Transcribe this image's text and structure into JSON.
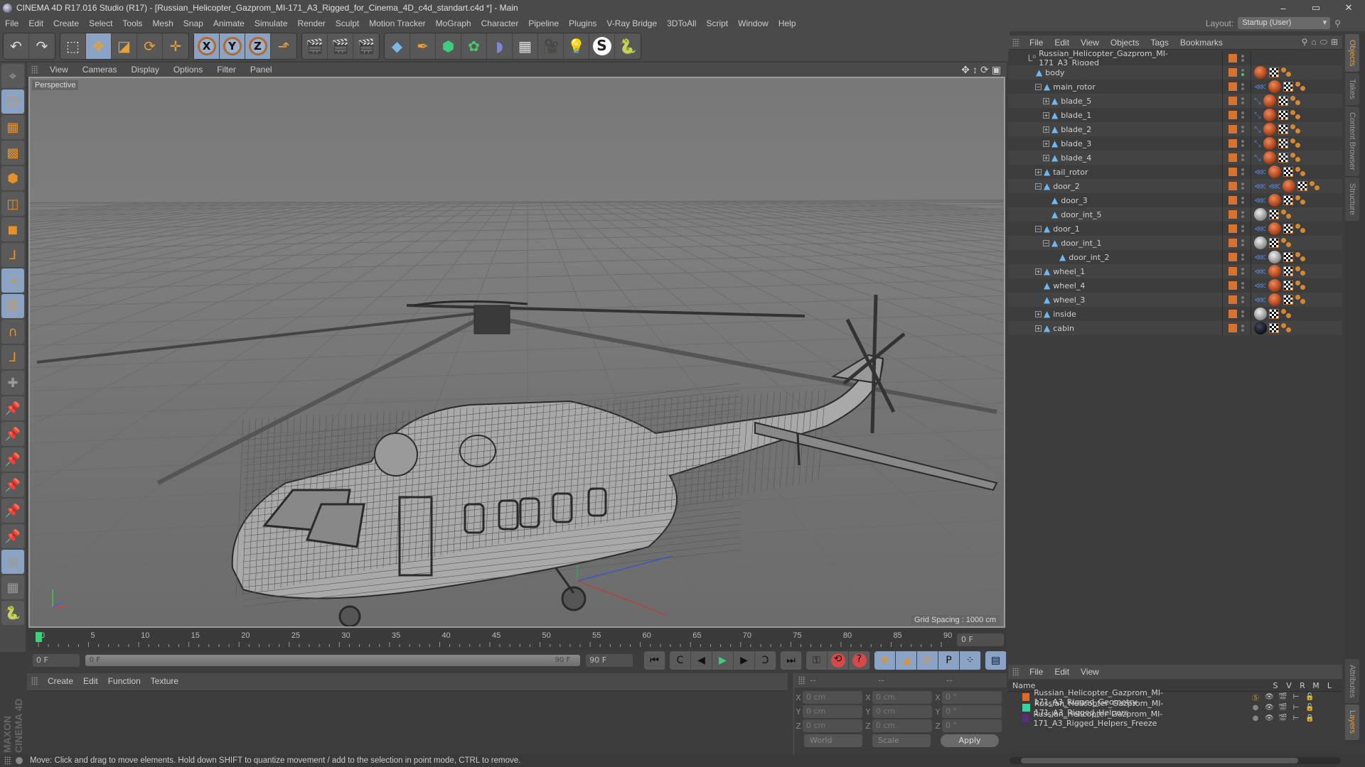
{
  "window": {
    "title": "CINEMA 4D R17.016 Studio (R17) - [Russian_Helicopter_Gazprom_MI-171_A3_Rigged_for_Cinema_4D_c4d_standart.c4d *] - Main",
    "controls": {
      "minimize": "–",
      "maximize": "▭",
      "close": "✕"
    }
  },
  "menubar": {
    "items": [
      "File",
      "Edit",
      "Create",
      "Select",
      "Tools",
      "Mesh",
      "Snap",
      "Animate",
      "Simulate",
      "Render",
      "Sculpt",
      "Motion Tracker",
      "MoGraph",
      "Character",
      "Pipeline",
      "Plugins",
      "V-Ray Bridge",
      "3DToAll",
      "Script",
      "Window",
      "Help"
    ],
    "layout_label": "Layout:",
    "layout_value": "Startup (User)"
  },
  "toolbar": {
    "buttons": [
      {
        "icon": "undo-icon",
        "glyph": "↶"
      },
      {
        "icon": "redo-icon",
        "glyph": "↷"
      },
      {
        "icon": "live-selection-icon",
        "glyph": "⬚"
      },
      {
        "icon": "move-icon",
        "glyph": "✥"
      },
      {
        "icon": "scale-icon",
        "glyph": "◪"
      },
      {
        "icon": "rotate-icon",
        "glyph": "⟳"
      },
      {
        "icon": "last-tool-icon",
        "glyph": "✛"
      },
      {
        "icon": "x-axis-icon",
        "glyph": "X"
      },
      {
        "icon": "y-axis-icon",
        "glyph": "Y"
      },
      {
        "icon": "z-axis-icon",
        "glyph": "Z"
      },
      {
        "icon": "coordinate-system-icon",
        "glyph": "⬏"
      },
      {
        "icon": "render-view-icon",
        "glyph": "🎬"
      },
      {
        "icon": "render-picture-viewer-icon",
        "glyph": "🎬"
      },
      {
        "icon": "render-settings-icon",
        "glyph": "🎬"
      },
      {
        "icon": "cube-icon",
        "glyph": "◆"
      },
      {
        "icon": "pen-icon",
        "glyph": "✒"
      },
      {
        "icon": "subdivision-icon",
        "glyph": "⬢"
      },
      {
        "icon": "cloner-icon",
        "glyph": "✿"
      },
      {
        "icon": "deformer-icon",
        "glyph": "◗"
      },
      {
        "icon": "floor-icon",
        "glyph": "▦"
      },
      {
        "icon": "camera-icon",
        "glyph": "🎥"
      },
      {
        "icon": "light-icon",
        "glyph": "💡"
      },
      {
        "icon": "vray-icon",
        "glyph": "S"
      },
      {
        "icon": "python-icon",
        "glyph": "🐍"
      }
    ]
  },
  "viewport": {
    "menu": [
      "View",
      "Cameras",
      "Display",
      "Options",
      "Filter",
      "Panel"
    ],
    "label": "Perspective",
    "grid_spacing": "Grid Spacing : 1000 cm"
  },
  "left_toolbar": [
    "model-mode-icon",
    "object-mode-icon",
    "texture-mode-icon",
    "workplane-mode-icon",
    "points-mode-icon",
    "edges-mode-icon",
    "polygons-mode-icon",
    "axis-icon",
    "tweak-mode-icon",
    "solo-icon",
    "snap-icon",
    "workplane-icon",
    "enable-axis-icon",
    "pin-icon",
    "pin-r-icon",
    "pin-psr-icon",
    "pin-c-icon",
    "pin-d-icon",
    "pin-x-icon",
    "lock-workplane-icon",
    "workplane-rotate-icon",
    "python-icon"
  ],
  "brand": "MAXON CINEMA 4D",
  "timeline": {
    "ticks": [
      "0",
      "5",
      "10",
      "15",
      "20",
      "25",
      "30",
      "35",
      "40",
      "45",
      "50",
      "55",
      "60",
      "65",
      "70",
      "75",
      "80",
      "85",
      "90"
    ],
    "current_frame": "0 F",
    "start_field": "0 F",
    "range_start": "0 F",
    "range_end": "90 F",
    "end_field": "90 F"
  },
  "transport": {
    "buttons": [
      "go-to-start",
      "prev-key",
      "prev-frame",
      "play",
      "next-frame",
      "next-key",
      "go-to-end",
      "keyframe-record",
      "auto-key",
      "key-help",
      "move-key",
      "scale-key",
      "rotate-key",
      "param-key",
      "pla-key",
      "timeline-icon"
    ],
    "glyphs": [
      "⏮",
      "C",
      "◀",
      "▶",
      "▶",
      "Ↄ",
      "⏭",
      "⚿",
      "⟲",
      "?",
      "✥",
      "◪",
      "⟳",
      "P",
      "⁘",
      "▤"
    ]
  },
  "material_manager": {
    "menu": [
      "Create",
      "Edit",
      "Function",
      "Texture"
    ]
  },
  "coordinates": {
    "headers": [
      "--",
      "--",
      "--"
    ],
    "rows": [
      {
        "axis": "X",
        "pos": "0 cm",
        "size": "0 cm",
        "rot": "0 °"
      },
      {
        "axis": "Y",
        "pos": "0 cm",
        "size": "0 cm",
        "rot": "0 °"
      },
      {
        "axis": "Z",
        "pos": "0 cm",
        "size": "0 cm",
        "rot": "0 °"
      }
    ],
    "space": "World",
    "mode": "Scale",
    "apply": "Apply"
  },
  "status_bar": "Move: Click and drag to move elements. Hold down SHIFT to quantize movement / add to the selection in point mode, CTRL to remove.",
  "object_manager": {
    "menu": [
      "File",
      "Edit",
      "View",
      "Objects",
      "Tags",
      "Bookmarks"
    ],
    "objects": [
      {
        "name": "Russian_Helicopter_Gazprom_MI-171_A3_Rigged",
        "depth": 0,
        "expander": "",
        "type": "null-L0",
        "tags": []
      },
      {
        "name": "body",
        "depth": 1,
        "expander": "",
        "type": "null",
        "tags": [
          "material",
          "checker",
          "points"
        ],
        "active": true
      },
      {
        "name": "main_rotor",
        "depth": 2,
        "expander": "−",
        "type": "null",
        "tags": [
          "ik",
          "material",
          "checker",
          "points"
        ]
      },
      {
        "name": "blade_5",
        "depth": 3,
        "expander": "+",
        "type": "null",
        "tags": [
          "bone",
          "material",
          "checker",
          "points"
        ]
      },
      {
        "name": "blade_1",
        "depth": 3,
        "expander": "+",
        "type": "null",
        "tags": [
          "bone",
          "material",
          "checker",
          "points"
        ]
      },
      {
        "name": "blade_2",
        "depth": 3,
        "expander": "+",
        "type": "null",
        "tags": [
          "bone",
          "material",
          "checker",
          "points"
        ]
      },
      {
        "name": "blade_3",
        "depth": 3,
        "expander": "+",
        "type": "null",
        "tags": [
          "bone",
          "material",
          "checker",
          "points"
        ]
      },
      {
        "name": "blade_4",
        "depth": 3,
        "expander": "+",
        "type": "null",
        "tags": [
          "bone",
          "material",
          "checker",
          "points"
        ]
      },
      {
        "name": "tail_rotor",
        "depth": 2,
        "expander": "+",
        "type": "null",
        "tags": [
          "ik",
          "material",
          "checker",
          "points"
        ]
      },
      {
        "name": "door_2",
        "depth": 2,
        "expander": "−",
        "type": "null",
        "tags": [
          "ik",
          "ik",
          "material",
          "checker",
          "points"
        ]
      },
      {
        "name": "door_3",
        "depth": 3,
        "expander": "",
        "type": "null",
        "tags": [
          "ik",
          "material",
          "checker",
          "points"
        ]
      },
      {
        "name": "door_int_5",
        "depth": 3,
        "expander": "",
        "type": "null",
        "tags": [
          "material-grey",
          "checker",
          "points"
        ]
      },
      {
        "name": "door_1",
        "depth": 2,
        "expander": "−",
        "type": "null",
        "tags": [
          "ik",
          "material",
          "checker",
          "points"
        ]
      },
      {
        "name": "door_int_1",
        "depth": 3,
        "expander": "−",
        "type": "null",
        "tags": [
          "material-grey",
          "checker",
          "points"
        ]
      },
      {
        "name": "door_int_2",
        "depth": 4,
        "expander": "",
        "type": "null",
        "tags": [
          "ik",
          "material-grey",
          "checker",
          "points"
        ]
      },
      {
        "name": "wheel_1",
        "depth": 2,
        "expander": "+",
        "type": "null",
        "tags": [
          "ik",
          "material",
          "checker",
          "points"
        ]
      },
      {
        "name": "wheel_4",
        "depth": 2,
        "expander": "",
        "type": "null",
        "tags": [
          "ik",
          "material",
          "checker",
          "points"
        ]
      },
      {
        "name": "wheel_3",
        "depth": 2,
        "expander": "",
        "type": "null",
        "tags": [
          "ik",
          "material",
          "checker",
          "points"
        ]
      },
      {
        "name": "inside",
        "depth": 2,
        "expander": "+",
        "type": "null",
        "tags": [
          "material-grey",
          "checker",
          "points"
        ]
      },
      {
        "name": "cabin",
        "depth": 2,
        "expander": "+",
        "type": "null",
        "tags": [
          "material-black",
          "checker",
          "points"
        ]
      }
    ]
  },
  "side_tabs": {
    "top": [
      {
        "label": "Objects",
        "active": true
      },
      {
        "label": "Takes"
      },
      {
        "label": "Content Browser"
      },
      {
        "label": "Structure"
      }
    ],
    "bottom": [
      {
        "label": "Attributes"
      },
      {
        "label": "Layers",
        "active": true
      }
    ]
  },
  "layer_manager": {
    "menu": [
      "File",
      "Edit",
      "View"
    ],
    "columns": [
      "Name",
      "S",
      "V",
      "R",
      "M",
      "L"
    ],
    "layers": [
      {
        "name": "Russian_Helicopter_Gazprom_MI-171_A3_Rigged_Geometry",
        "color": "#d8692f",
        "solo": true,
        "locked": false
      },
      {
        "name": "Russian_Helicopter_Gazprom_MI-171_A3_Rigged_Helpers",
        "color": "#2ed6a0",
        "solo": false,
        "locked": false
      },
      {
        "name": "Russian_Helicopter_Gazprom_MI-171_A3_Rigged_Helpers_Freeze",
        "color": "#5a2e7a",
        "solo": false,
        "locked": true
      }
    ]
  },
  "colors": {
    "accent_selected": "#8aa3c4",
    "orange_tool": "#e8a030",
    "layer_orange": "#d87231",
    "timeline_cursor": "#3fcf7a"
  }
}
